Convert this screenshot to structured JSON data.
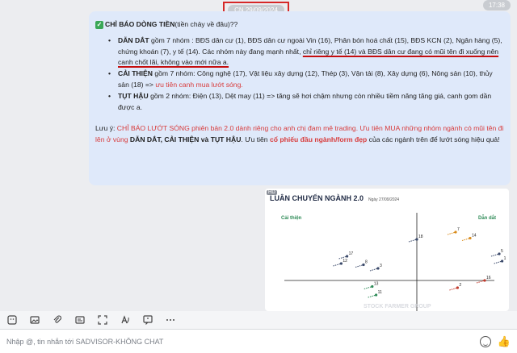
{
  "date_separator": "CN 29/09/2024",
  "time_badge": "17:38",
  "message": {
    "title_emoji": "✓",
    "title_bold": "CHỈ BÁO DÒNG TIỀN",
    "title_rest": " (tiền chảy về đâu)??",
    "bullets": [
      {
        "head": "DẪN DẮT",
        "text_a": " gồm 7 nhóm : BĐS dân cư (1), BĐS dân cư ngoài Vin (16), Phân bón hoá chất (15), BĐS KCN (2), Ngân hàng (5), chứng khoán (7), y tế (14). Các nhóm này đang mạnh nhất, ",
        "underlined": "chỉ riêng y tế (14) và BĐS dân cư đang có mũi tên đi xuống nên canh chốt lãi, không vào mới nữa a.",
        "text_b": ""
      },
      {
        "head": "CẢI THIỆN",
        "text_a": " gồm 7 nhóm: Công nghệ (17), Vật liệu xây dựng (12), Thép (3), Vận tải (8), Xây dựng (6), Nông sản (10), thủy sản (18) => ",
        "red": "ưu tiên canh mua lướt sóng.",
        "text_b": ""
      },
      {
        "head": "TỤT HẬU",
        "text_a": " gồm 2 nhóm: Điện (13), Dệt may (11) => tăng sẽ hơi chậm nhưng còn nhiều tiềm năng tăng giá, canh gom dần được a.",
        "text_b": ""
      }
    ],
    "note_label": "Lưu ý:",
    "note_red": " CHỈ BÁO LƯỚT SÓNG phiên bản 2.0 dành riêng cho anh chị đam mê trading. Ưu tiên MUA những nhóm ngành có mũi tên đi lên ở vùng ",
    "note_bold": "DẪN DẮT, CẢI THIỆN và TỤT HẬU",
    "note_mid": ". Ưu tiên ",
    "note_red2": "cổ phiếu đầu ngành/form đẹp",
    "note_end": " của các ngành trên để lướt sóng hiệu quả!"
  },
  "chart_card": {
    "hd": "HD",
    "title": "LUÂN CHUYỂN NGÀNH 2.0",
    "date": "Ngày 27/09/2024",
    "left_label": "Cải thiện",
    "right_label": "Dẫn dắt",
    "watermark": "STOCK FARMER GROUP"
  },
  "chart_data": {
    "type": "scatter",
    "title": "LUÂN CHUYỂN NGÀNH 2.0",
    "quadrants": [
      "Cải thiện",
      "Dẫn dắt"
    ],
    "points": [
      {
        "label": "12",
        "x": -0.78,
        "y": 0.14,
        "color": "#3b4a6b"
      },
      {
        "label": "17",
        "x": -0.72,
        "y": 0.2,
        "color": "#3b4a6b"
      },
      {
        "label": "8",
        "x": -0.55,
        "y": 0.13,
        "color": "#3b4a6b"
      },
      {
        "label": "3",
        "x": -0.4,
        "y": 0.1,
        "color": "#3b4a6b"
      },
      {
        "label": "18",
        "x": 0.0,
        "y": 0.34,
        "color": "#3b4a6b"
      },
      {
        "label": "7",
        "x": 0.4,
        "y": 0.4,
        "color": "#d98c1c"
      },
      {
        "label": "14",
        "x": 0.55,
        "y": 0.35,
        "color": "#d98c1c"
      },
      {
        "label": "5",
        "x": 0.85,
        "y": 0.22,
        "color": "#3b4a6b"
      },
      {
        "label": "1",
        "x": 0.88,
        "y": 0.16,
        "color": "#3b4a6b"
      },
      {
        "label": "16",
        "x": 0.7,
        "y": 0.0,
        "color": "#c0392b"
      },
      {
        "label": "2",
        "x": 0.42,
        "y": -0.06,
        "color": "#c0392b"
      },
      {
        "label": "13",
        "x": -0.46,
        "y": -0.05,
        "color": "#2e8b57"
      },
      {
        "label": "11",
        "x": -0.42,
        "y": -0.12,
        "color": "#2e8b57"
      }
    ]
  },
  "toolbar_icons": [
    "sticker-icon",
    "image-icon",
    "attach-icon",
    "contact-card-icon",
    "screenshot-icon",
    "text-format-icon",
    "quote-icon",
    "more-icon"
  ],
  "input": {
    "placeholder": "Nhập @, tin nhắn tới SADVISOR-KHÔNG CHAT",
    "like_icon": "👍"
  }
}
